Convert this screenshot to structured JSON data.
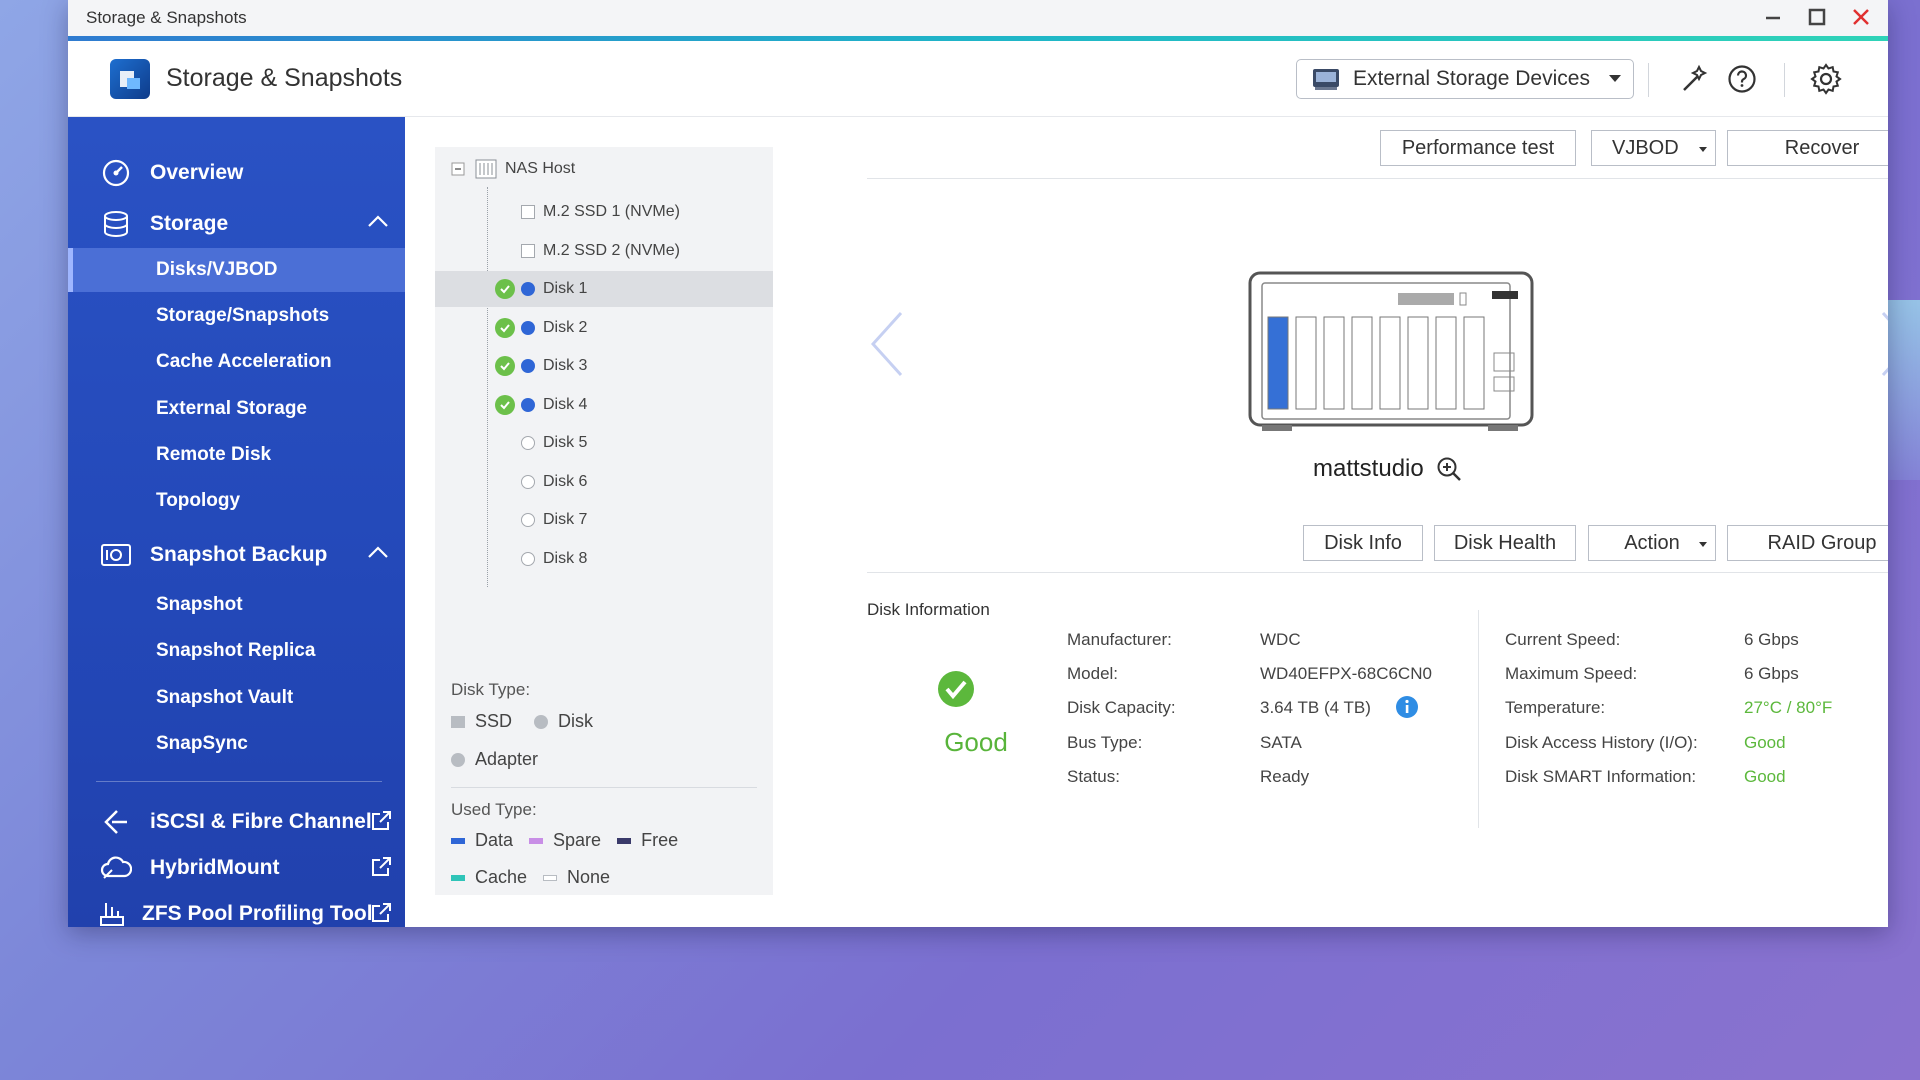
{
  "window": {
    "title": "Storage & Snapshots"
  },
  "app": {
    "title": "Storage & Snapshots",
    "ext_dropdown_label": "External Storage Devices"
  },
  "sidebar": {
    "overview": "Overview",
    "storage": "Storage",
    "storage_items": [
      "Disks/VJBOD",
      "Storage/Snapshots",
      "Cache Acceleration",
      "External Storage",
      "Remote Disk",
      "Topology"
    ],
    "snapshot_backup": "Snapshot Backup",
    "snapshot_items": [
      "Snapshot",
      "Snapshot Replica",
      "Snapshot Vault",
      "SnapSync"
    ],
    "iscsi": "iSCSI & Fibre Channel",
    "hybridmount": "HybridMount",
    "zfs": "ZFS Pool Profiling Tool"
  },
  "tree": {
    "root": "NAS Host",
    "items": [
      {
        "label": "M.2 SSD 1 (NVMe)"
      },
      {
        "label": "M.2 SSD 2 (NVMe)"
      },
      {
        "label": "Disk 1"
      },
      {
        "label": "Disk 2"
      },
      {
        "label": "Disk 3"
      },
      {
        "label": "Disk 4"
      },
      {
        "label": "Disk 5"
      },
      {
        "label": "Disk 6"
      },
      {
        "label": "Disk 7"
      },
      {
        "label": "Disk 8"
      }
    ]
  },
  "legend": {
    "disk_type_title": "Disk Type:",
    "ssd": "SSD",
    "disk": "Disk",
    "adapter": "Adapter",
    "used_type_title": "Used Type:",
    "data": "Data",
    "spare": "Spare",
    "free": "Free",
    "cache": "Cache",
    "none": "None"
  },
  "toolbar": {
    "performance_test": "Performance test",
    "vjbod": "VJBOD",
    "recover": "Recover"
  },
  "nas": {
    "name": "mattstudio"
  },
  "disk_actions": {
    "disk_info": "Disk Info",
    "disk_health": "Disk Health",
    "action": "Action",
    "raid_group": "RAID Group"
  },
  "disk_info": {
    "title": "Disk Information",
    "status_text": "Good",
    "left": [
      {
        "label": "Manufacturer:",
        "value": "WDC"
      },
      {
        "label": "Model:",
        "value": "WD40EFPX-68C6CN0"
      },
      {
        "label": "Disk Capacity:",
        "value": "3.64 TB (4 TB)"
      },
      {
        "label": "Bus Type:",
        "value": "SATA"
      },
      {
        "label": "Status:",
        "value": "Ready"
      }
    ],
    "right": [
      {
        "label": "Current Speed:",
        "value": "6 Gbps"
      },
      {
        "label": "Maximum Speed:",
        "value": "6 Gbps"
      },
      {
        "label": "Temperature:",
        "value": "27°C / 80°F"
      },
      {
        "label": "Disk Access History (I/O):",
        "value": "Good"
      },
      {
        "label": "Disk SMART Information:",
        "value": "Good"
      }
    ]
  },
  "colors": {
    "sidebar": "#2348b8",
    "good_green": "#5cb83c",
    "disk_blue": "#2f66d6",
    "accent_teal": "#1fb5c8"
  }
}
